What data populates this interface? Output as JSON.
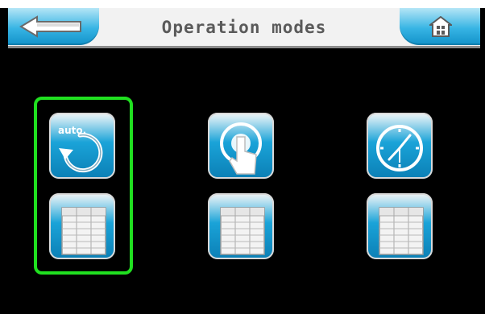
{
  "header": {
    "title": "Operation modes",
    "back_icon": "back-arrow-icon",
    "home_icon": "home-icon"
  },
  "modes": [
    {
      "icon": "auto-mode-icon",
      "label": "auto.",
      "selected": true
    },
    {
      "icon": "manual-touch-icon",
      "selected": false
    },
    {
      "icon": "timer-clock-icon",
      "selected": false
    }
  ],
  "tables": [
    {
      "icon": "table-icon"
    },
    {
      "icon": "table-icon"
    },
    {
      "icon": "table-icon"
    }
  ],
  "colors": {
    "selection": "#20e020",
    "accent": "#1aa3d8",
    "background": "#000000"
  }
}
